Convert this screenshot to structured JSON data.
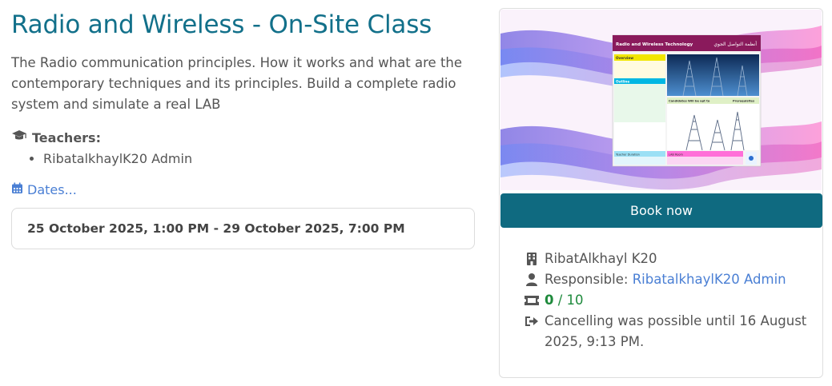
{
  "course": {
    "title": "Radio and Wireless - On-Site Class",
    "description": "The Radio communication principles. How it works and what are the contemporary techniques and its principles. Build a complete radio system and simulate a real LAB",
    "teachers_label": "Teachers:",
    "teachers": [
      "RibatalkhaylK20 Admin"
    ],
    "dates_link": "Dates...",
    "date_range": "25 October 2025, 1:00 PM - 29 October 2025, 7:00 PM"
  },
  "sidebar": {
    "book_button": "Book now",
    "location": "RibatAlkhayl K20",
    "responsible_label": "Responsible: ",
    "responsible_name": "RibatalkhaylK20 Admin",
    "seats_booked": "0",
    "seats_separator": " / ",
    "seats_total": "10",
    "cancel_text": "Cancelling was possible until 16 August 2025, 9:13 PM."
  },
  "poster": {
    "heading": "Radio and Wireless Technology",
    "heading_arabic": "أنظمة التواصل الجوي",
    "overview_label": "Overview",
    "outline_label": "Outline",
    "candidates_label": "Candidates Will be apt to",
    "prerequisites_label": "Prerequisites",
    "teacher_label": "Teacher Duration",
    "lab_label": "LAB Room"
  },
  "colors": {
    "title": "#12708a",
    "button": "#0f6a80",
    "link": "#4a7fd4",
    "booked": "#1e8a3c"
  }
}
